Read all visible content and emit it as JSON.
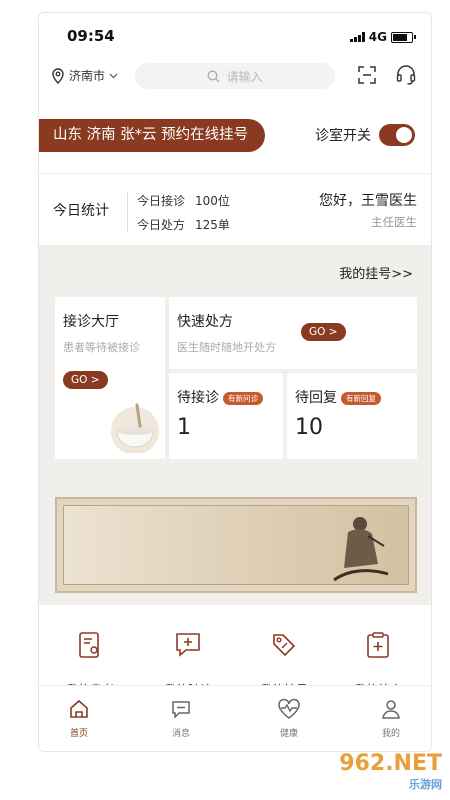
{
  "status": {
    "time": "09:54",
    "network": "4G"
  },
  "header": {
    "city": "济南市",
    "search_placeholder": "请输入",
    "icons": [
      "location-pin-icon",
      "chevron-down-icon",
      "search-icon",
      "scan-icon",
      "headset-icon"
    ]
  },
  "banner": {
    "text": "山东 济南 张*云 预约在线挂号"
  },
  "clinic_switch": {
    "label": "诊室开关",
    "on": true
  },
  "stats": {
    "title": "今日统计",
    "visits_label": "今日接诊",
    "visits_value": "100位",
    "rx_label": "今日处方",
    "rx_value": "125单",
    "greeting": "您好，王雪医生",
    "role": "主任医生"
  },
  "my_registration_link": "我的挂号>>",
  "cards": {
    "hall": {
      "title": "接诊大厅",
      "subtitle": "患者等待被接诊",
      "go": "GO >"
    },
    "quick_rx": {
      "title": "快速处方",
      "subtitle": "医生随时随地开处方",
      "go": "GO >"
    },
    "pending": {
      "title": "待接诊",
      "badge": "有新问诊",
      "count": "1"
    },
    "reply": {
      "title": "待回复",
      "badge": "有新回复",
      "count": "10"
    }
  },
  "quick_actions": [
    {
      "label": "我的患者",
      "icon": "patient-record-icon"
    },
    {
      "label": "我的随访",
      "icon": "follow-up-icon"
    },
    {
      "label": "我的挂号",
      "icon": "tag-icon"
    },
    {
      "label": "我的处方",
      "icon": "prescription-icon"
    }
  ],
  "tabs": [
    {
      "label": "首页",
      "icon": "home-icon",
      "active": true
    },
    {
      "label": "消息",
      "icon": "message-icon",
      "active": false
    },
    {
      "label": "健康",
      "icon": "heart-pulse-icon",
      "active": false
    },
    {
      "label": "我的",
      "icon": "user-icon",
      "active": false
    }
  ],
  "watermark": {
    "main": "962.NET",
    "sub": "乐游网"
  },
  "colors": {
    "accent": "#8b3a22",
    "badge": "#c65a2e",
    "panel": "#f1efec"
  }
}
